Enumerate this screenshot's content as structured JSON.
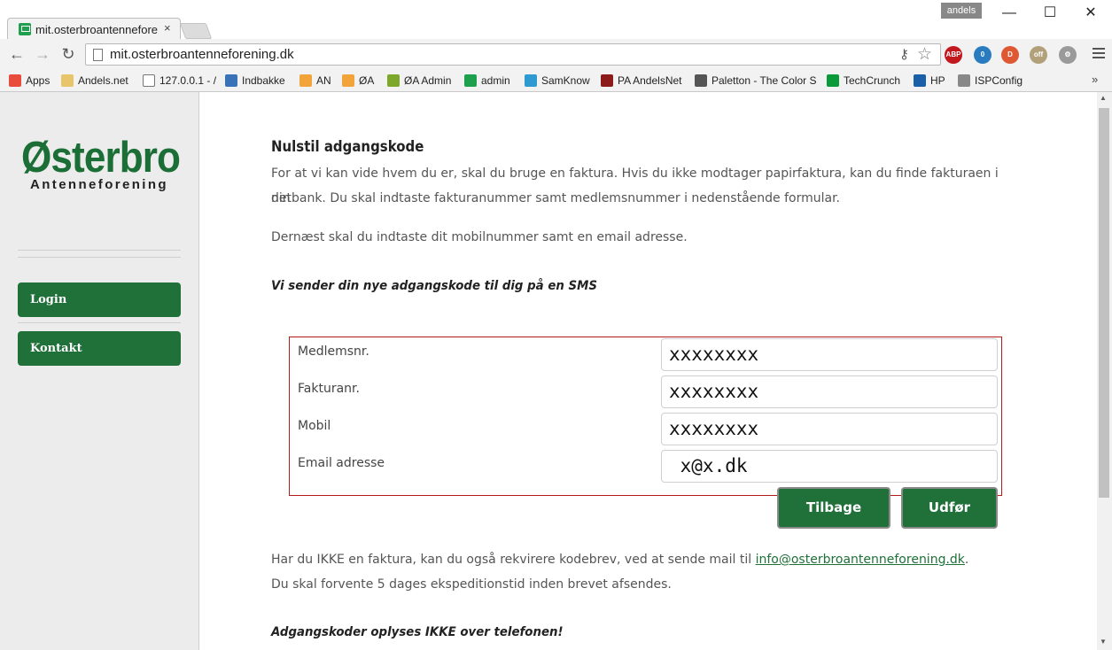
{
  "browser": {
    "tab_title": "mit.osterbroantenneforeni",
    "tab_close": "×",
    "profile": "andels",
    "window_controls": {
      "minimize": "—",
      "maximize": "☐",
      "close": "✕"
    },
    "url": "mit.osterbroantenneforening.dk",
    "nav": {
      "back": "←",
      "forward": "→",
      "reload": "↻"
    },
    "extensions": [
      {
        "name": "adblock-plus-icon",
        "label": "ABP",
        "color": "#c3171e"
      },
      {
        "name": "ghostery-icon",
        "label": "0",
        "color": "#2a7cc0"
      },
      {
        "name": "duckduckgo-icon",
        "label": "D",
        "color": "#de5833"
      },
      {
        "name": "off-switch-icon",
        "label": "off",
        "color": "#b1a07a"
      },
      {
        "name": "gear-extension-icon",
        "label": "⚙",
        "color": "#9a9a9a"
      }
    ],
    "bookmarks": [
      {
        "label": "Apps",
        "icon": "apps-grid-icon",
        "color": "#e84c3d"
      },
      {
        "label": "Andels.net",
        "icon": "folder-icon",
        "color": "#e8c56b"
      },
      {
        "label": "127.0.0.1 - /",
        "icon": "page-icon",
        "color": "#ffffff"
      },
      {
        "label": "Indbakke",
        "icon": "mail-icon",
        "color": "#3a72b8"
      },
      {
        "label": "AN",
        "icon": "pma-icon",
        "color": "#f2a33a"
      },
      {
        "label": "ØA",
        "icon": "pma-icon",
        "color": "#f2a33a"
      },
      {
        "label": "ØA Admin",
        "icon": "ring-icon",
        "color": "#7ea82c"
      },
      {
        "label": "admin",
        "icon": "admin-icon",
        "color": "#1ea04e"
      },
      {
        "label": "SamKnow",
        "icon": "samknow-icon",
        "color": "#2e9ad0"
      },
      {
        "label": "PA AndelsNet",
        "icon": "pa-icon",
        "color": "#8c1c1c"
      },
      {
        "label": "Paletton - The Color S",
        "icon": "palette-icon",
        "color": "#555555"
      },
      {
        "label": "TechCrunch",
        "icon": "techcrunch-icon",
        "color": "#0a9a3a"
      },
      {
        "label": "HP",
        "icon": "hp-icon",
        "color": "#1a5fa8"
      },
      {
        "label": "ISPConfig",
        "icon": "ispconfig-icon",
        "color": "#888888"
      }
    ],
    "bookmarks_more": "»"
  },
  "sidebar": {
    "logo_main": "Østerbro",
    "logo_sub": "Antenneforening",
    "buttons": [
      {
        "label": "Login"
      },
      {
        "label": "Kontakt"
      }
    ]
  },
  "main": {
    "title": "Nulstil adgangskode",
    "intro_line1": "For at vi kan vide hvem du er, skal du bruge en faktura. Hvis du ikke modtager papirfaktura, kan du finde fakturaen i din",
    "intro_line2": "netbank. Du skal indtaste fakturanummer samt medlemsnummer i nedenstående formular.",
    "intro2": "Dernæst skal du indtaste dit mobilnummer samt en email adresse.",
    "sms_note": "Vi sender din nye adgangskode til dig på en SMS",
    "form": {
      "fields": [
        {
          "label": "Medlemsnr.",
          "value": "xxxxxxxx"
        },
        {
          "label": "Fakturanr.",
          "value": "xxxxxxxx"
        },
        {
          "label": "Mobil",
          "value": "xxxxxxxx"
        },
        {
          "label": "Email adresse",
          "value": " x@x.dk"
        }
      ],
      "back_label": "Tilbage",
      "submit_label": "Udfør"
    },
    "footer_line1": "Har du IKKE en faktura, kan du også rekvirere kodebrev, ved at sende mail til ",
    "footer_email": "info@osterbroantenneforening.dk",
    "footer_line1_end": ".",
    "footer_line2": "Du skal forvente 5 dages ekspeditionstid inden brevet afsendes.",
    "phone_note": "Adgangskoder oplyses IKKE over telefonen!"
  }
}
